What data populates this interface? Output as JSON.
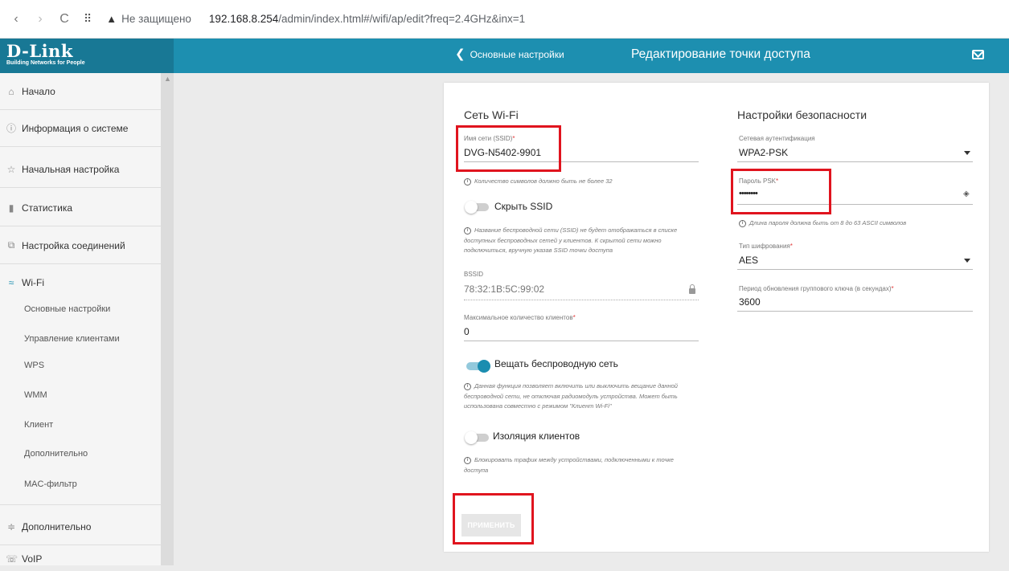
{
  "browser": {
    "back": "‹",
    "forward": "›",
    "reload": "C",
    "apps": "⠿",
    "warning_icon": "warning-triangle-icon",
    "insecure": "Не защищено",
    "url_host": "192.168.8.254",
    "url_path": "/admin/index.html#/wifi/ap/edit?freq=2.4GHz&inx=1"
  },
  "header": {
    "logo": "D-Link",
    "logo_tagline": "Building Networks for People",
    "back_link": "Основные настройки",
    "title": "Редактирование точки доступа",
    "brand_color": "#1d8fb0"
  },
  "sidebar": {
    "items": [
      {
        "label": "Начало",
        "icon": "home-icon"
      },
      {
        "label": "Информация о системе",
        "icon": "info-icon"
      },
      {
        "label": "Начальная настройка",
        "icon": "wizard-icon"
      },
      {
        "label": "Статистика",
        "icon": "stats-icon"
      },
      {
        "label": "Настройка соединений",
        "icon": "connections-icon"
      }
    ],
    "wifi": {
      "label": "Wi-Fi",
      "icon": "wifi-icon",
      "subitems": [
        "Основные настройки",
        "Управление клиентами",
        "WPS",
        "WMM",
        "Клиент",
        "Дополнительно",
        "MAC-фильтр"
      ]
    },
    "bottom_items": [
      {
        "label": "Дополнительно",
        "icon": "sliders-icon"
      },
      {
        "label": "VoIP",
        "icon": "phone-icon"
      }
    ]
  },
  "wifi_section": {
    "title": "Сеть Wi-Fi",
    "ssid_label": "Имя сети (SSID)",
    "ssid_value": "DVG-N5402-9901",
    "ssid_hint": "Количество символов должно быть не более 32",
    "hide_ssid_label": "Скрыть SSID",
    "hide_ssid_on": false,
    "hide_ssid_hint_1": "Название беспроводной сети (SSID) не будет отображаться в списке",
    "hide_ssid_hint_2": "доступных беспроводных сетей у клиентов. К скрытой сети можно",
    "hide_ssid_hint_3": "подключиться, вручную указав SSID точки доступа",
    "bssid_label": "BSSID",
    "bssid_value": "78:32:1B:5C:99:02",
    "max_clients_label": "Максимальное количество клиентов",
    "max_clients_value": "0",
    "broadcast_label": "Вещать беспроводную сеть",
    "broadcast_on": true,
    "broadcast_hint_1": "Данная функция позволяет включить или выключить вещание данной",
    "broadcast_hint_2": "беспроводной сети, не отключая радиомодуль устройства. Может быть",
    "broadcast_hint_3": "использована совместно с режимом \"Клиент Wi-Fi\"",
    "isolation_label": "Изоляция клиентов",
    "isolation_on": false,
    "isolation_hint_1": "Блокировать трафик между устройствами, подключенными к точке",
    "isolation_hint_2": "доступа",
    "apply_button": "ПРИМЕНИТЬ"
  },
  "security_section": {
    "title": "Настройки безопасности",
    "auth_label": "Сетевая аутентификация",
    "auth_value": "WPA2-PSK",
    "psk_label": "Пароль PSK",
    "psk_value": "••••••••",
    "psk_hint": "Длина пароля должна быть от 8 до 63 ASCII символов",
    "cipher_label": "Тип шифрования",
    "cipher_value": "AES",
    "rekey_label": "Период обновления группового ключа (в секундах)",
    "rekey_value": "3600"
  },
  "highlight_color": "#e0141e"
}
